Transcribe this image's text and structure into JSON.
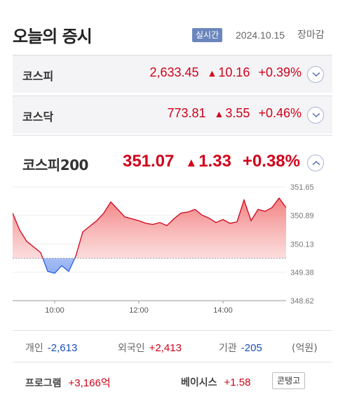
{
  "header": {
    "title": "오늘의 증시",
    "realtime_badge": "실시간",
    "date": "2024.10.15",
    "market_state": "장마감"
  },
  "indices": [
    {
      "name": "코스피",
      "value": "2,633.45",
      "change": "10.16",
      "rate": "+0.39%",
      "direction": "up"
    },
    {
      "name": "코스닥",
      "value": "773.81",
      "change": "3.55",
      "rate": "+0.46%",
      "direction": "up"
    }
  ],
  "kospi200": {
    "name": "코스피200",
    "value": "351.07",
    "change": "1.33",
    "rate": "+0.38%",
    "direction": "up"
  },
  "colors": {
    "up": "#d0021b",
    "down": "#1b4fb8",
    "badge": "#6b86bd"
  },
  "icons": {
    "up_arrow": "▲",
    "expand": "chevron-down-icon",
    "collapse": "chevron-up-icon"
  },
  "chart_data": {
    "type": "area",
    "x": [
      "09:00",
      "09:10",
      "09:20",
      "09:30",
      "09:40",
      "09:50",
      "10:00",
      "10:10",
      "10:20",
      "10:30",
      "10:40",
      "10:50",
      "11:00",
      "11:10",
      "11:20",
      "11:30",
      "11:40",
      "11:50",
      "12:00",
      "12:10",
      "12:20",
      "12:30",
      "12:40",
      "12:50",
      "13:00",
      "13:10",
      "13:20",
      "13:30",
      "13:40",
      "13:50",
      "14:00",
      "14:10",
      "14:20",
      "14:30",
      "14:40",
      "14:50",
      "15:00",
      "15:10",
      "15:20",
      "15:30"
    ],
    "series": [
      {
        "values": [
          350.95,
          350.5,
          350.2,
          350.05,
          349.9,
          349.4,
          349.35,
          349.55,
          349.4,
          349.8,
          350.45,
          350.6,
          350.75,
          350.95,
          351.25,
          351.05,
          350.85,
          350.8,
          350.75,
          350.68,
          350.65,
          350.7,
          350.62,
          350.8,
          350.95,
          350.98,
          351.05,
          350.9,
          350.82,
          350.7,
          350.78,
          350.68,
          350.72,
          351.3,
          350.75,
          351.05,
          351.0,
          351.1,
          351.35,
          351.1
        ]
      }
    ],
    "baseline": 349.75,
    "y_ticks": [
      "351.65",
      "350.89",
      "350.13",
      "349.38",
      "348.62"
    ],
    "ylim": [
      348.62,
      351.65
    ],
    "x_ticks": [
      "10:00",
      "12:00",
      "14:00"
    ],
    "xlim": [
      "09:00",
      "15:30"
    ]
  },
  "flows": {
    "individual_label": "개인",
    "individual_value": "-2,613",
    "foreign_label": "외국인",
    "foreign_value": "+2,413",
    "institution_label": "기관",
    "institution_value": "-205",
    "unit": "(억원)"
  },
  "program": {
    "label": "프로그램",
    "value": "+3,166억"
  },
  "basis": {
    "label": "베이시스",
    "value": "+1.58",
    "state": "콘탱고"
  }
}
